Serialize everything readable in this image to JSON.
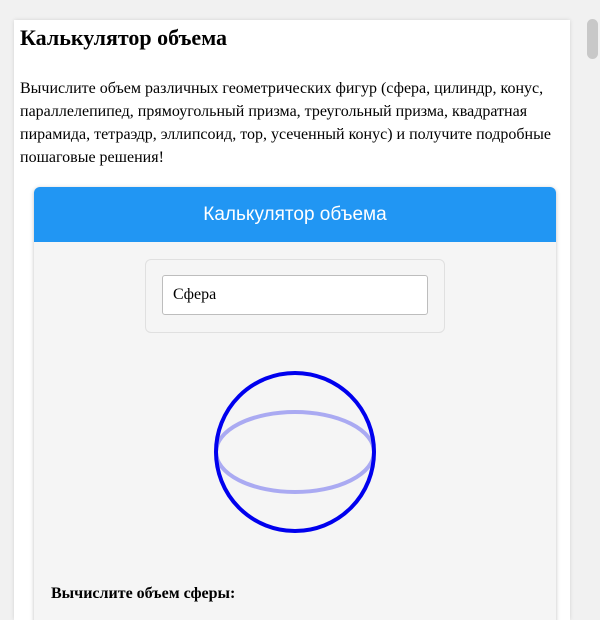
{
  "page": {
    "title": "Калькулятор объема",
    "description": "Вычислите объем различных геометрических фигур (сфера, цилиндр, конус, параллелепипед, прямоугольный призма, треугольный призма, квадратная пирамида, тетраэдр, эллипсоид, тор, усеченный конус) и получите подробные пошаговые решения!"
  },
  "calculator": {
    "header": "Калькулятор объема",
    "selected_shape": "Сфера",
    "section_title": "Вычислите объем сферы:"
  },
  "colors": {
    "header": "#2196f3",
    "shape_outline": "#0000ee",
    "shape_equator": "#aaaaf2"
  },
  "icons": {
    "shape": "sphere-icon"
  }
}
